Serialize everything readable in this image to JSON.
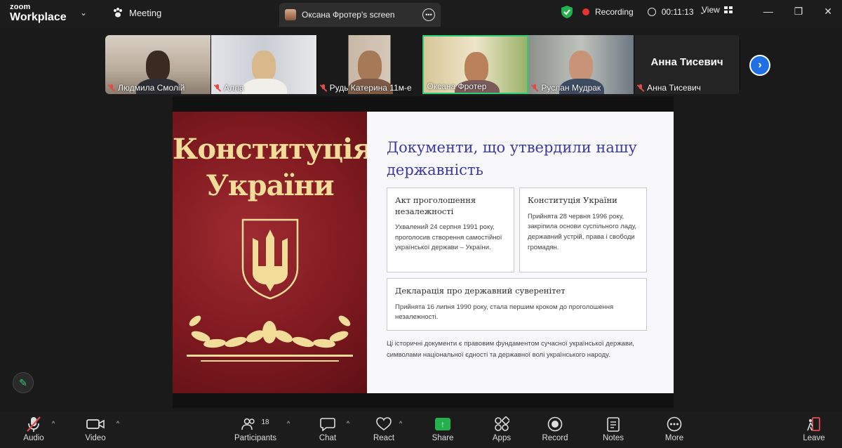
{
  "app": {
    "logo_line1": "zoom",
    "logo_line2": "Workplace"
  },
  "header": {
    "meeting_label": "Meeting",
    "screen_tab_label": "Оксана Фротер's screen",
    "recording_label": "Recording",
    "timer": "00:11:13",
    "view_label": "View"
  },
  "participants": [
    {
      "name": "Людмила Смолій",
      "muted": true
    },
    {
      "name": "Алла",
      "muted": true
    },
    {
      "name": "Рудь Катерина 11м-е",
      "muted": true
    },
    {
      "name": "Оксана Фротер",
      "muted": false,
      "active": true
    },
    {
      "name": "Руслан Мудрак",
      "muted": true
    },
    {
      "name": "Анна Тисевич",
      "muted": true,
      "display_text": "Анна Тисевич"
    }
  ],
  "slide": {
    "book_title_line1": "Конституція",
    "book_title_line2": "України",
    "heading": "Документи, що утвердили нашу державність",
    "card1_title": "Акт проголошення незалежності",
    "card1_body": "Ухвалений 24 серпня 1991 року, проголосив створення самостійної української держави – України.",
    "card2_title": "Конституція України",
    "card2_body": "Прийнята 28 червня 1996 року, закріпила основи суспільного ладу, державний устрій, права і свободи громадян.",
    "card3_title": "Декларація про державний суверенітет",
    "card3_body": "Прийнята 16 липня 1990 року, стала першим кроком до проголошення незалежності.",
    "footer_text": "Ці історичні документи є правовим фундаментом сучасної української держави, символами національної єдності та державної волі українського народу."
  },
  "toolbar": {
    "audio": "Audio",
    "video": "Video",
    "participants": "Participants",
    "participants_count": "18",
    "chat": "Chat",
    "react": "React",
    "share": "Share",
    "apps": "Apps",
    "record": "Record",
    "notes": "Notes",
    "more": "More",
    "leave": "Leave"
  },
  "colors": {
    "accent_green": "#22b14c",
    "record_red": "#e5342f",
    "slide_heading": "#3b3aa0",
    "book_red": "#8e2228",
    "book_gold": "#f2dc9a"
  }
}
